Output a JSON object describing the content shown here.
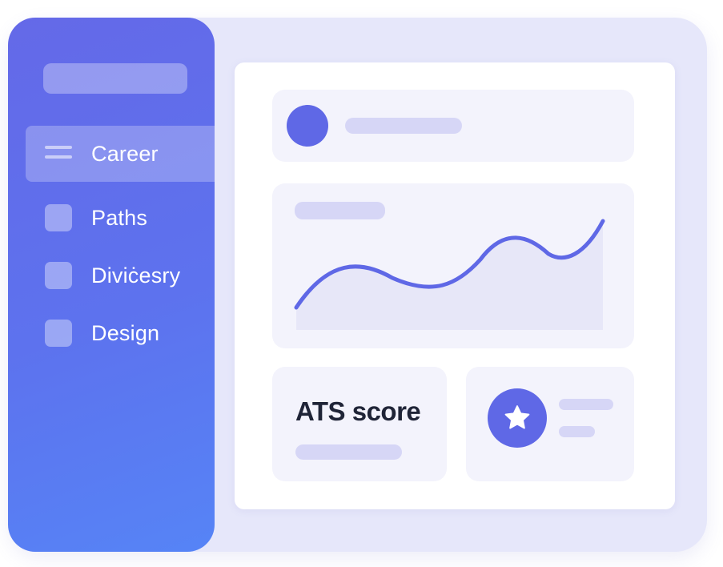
{
  "sidebar": {
    "items": [
      {
        "label": "Career",
        "icon": "menu-icon",
        "active": true
      },
      {
        "label": "Paths",
        "icon": "square-icon",
        "active": false
      },
      {
        "label": "Diviċesry",
        "icon": "square-icon",
        "active": false
      },
      {
        "label": "Design",
        "icon": "square-icon",
        "active": false
      }
    ]
  },
  "main": {
    "profile_card": {
      "avatar_icon": "avatar-circle"
    },
    "trend_card": {
      "line_icon": "line-chart"
    },
    "ats_card": {
      "title": "ATS score"
    },
    "rating_card": {
      "icon": "star-icon"
    }
  },
  "colors": {
    "accent": "#5f68e6",
    "sidebar_top": "#6469e8",
    "sidebar_bottom": "#5684f6",
    "placeholder_bar": "#d6d6f6",
    "card_background": "#f3f3fc",
    "window_background": "#e6e7fa"
  }
}
